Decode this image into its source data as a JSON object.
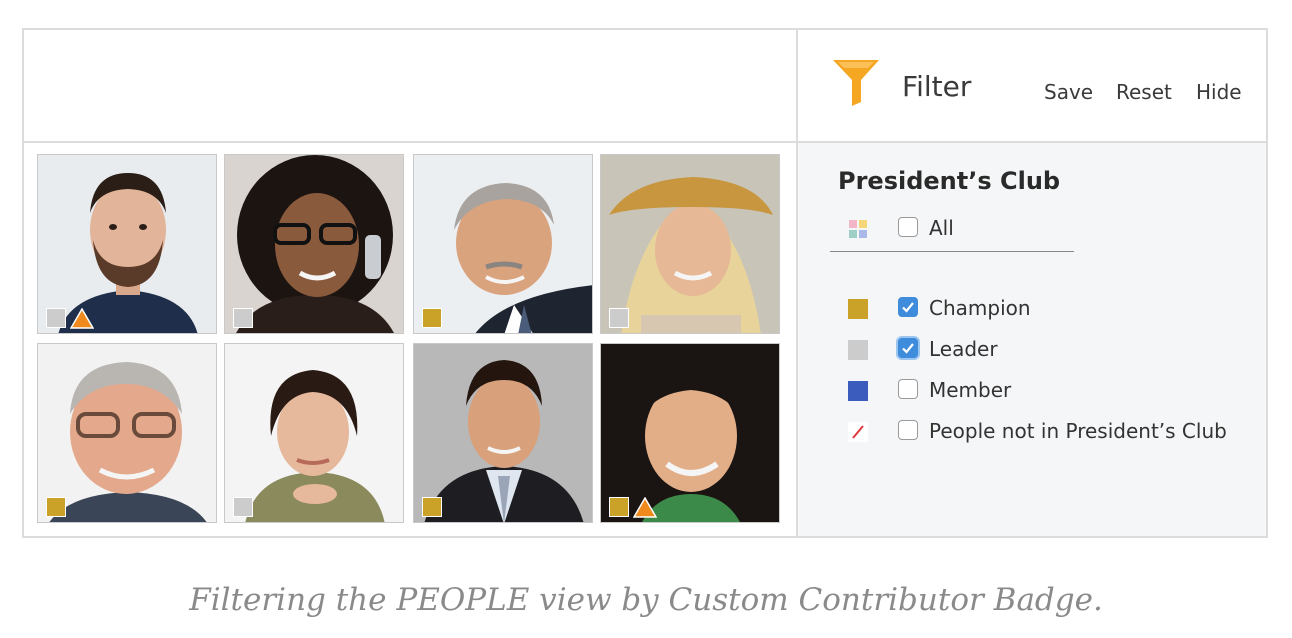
{
  "filter": {
    "title": "Filter",
    "actions": {
      "save": "Save",
      "reset": "Reset",
      "hide": "Hide"
    },
    "icon": "funnel-icon",
    "accent_color": "#f5a623"
  },
  "panel": {
    "title": "President’s Club",
    "all_label": "All",
    "options": [
      {
        "label": "Champion",
        "checked": true,
        "swatch": "#c9a227"
      },
      {
        "label": "Leader",
        "checked": true,
        "swatch": "#cccccc"
      },
      {
        "label": "Member",
        "checked": false,
        "swatch": "#3b5bbd"
      },
      {
        "label": "People not in President’s Club",
        "checked": false,
        "swatch": "none-slash-icon"
      }
    ]
  },
  "people": [
    {
      "badge": "leader",
      "warning": true
    },
    {
      "badge": "leader",
      "warning": false
    },
    {
      "badge": "champion",
      "warning": false
    },
    {
      "badge": "leader",
      "warning": false
    },
    {
      "badge": "champion",
      "warning": false
    },
    {
      "badge": "leader",
      "warning": false
    },
    {
      "badge": "champion",
      "warning": false
    },
    {
      "badge": "champion",
      "warning": true
    }
  ],
  "badge_colors": {
    "champion": "#c9a227",
    "leader": "#cccccc",
    "warning": "#f08a1c"
  },
  "caption": "Filtering the PEOPLE view by Custom Contributor Badge."
}
